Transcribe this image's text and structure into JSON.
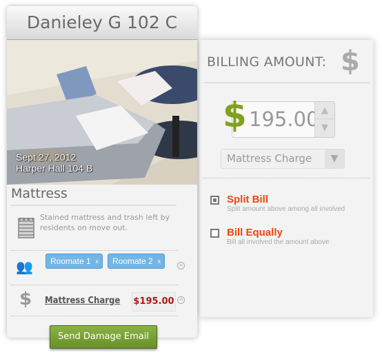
{
  "card": {
    "title": "Danieley G 102 C",
    "photo": {
      "date": "Sept 27, 2012",
      "location": "Harper Hall 104 B"
    },
    "item_title": "Mattress",
    "description": "Stained mattress and trash left by residents on move out.",
    "roommates": [
      {
        "label": "Roomate 1",
        "remove": "x"
      },
      {
        "label": "Roomate 2",
        "remove": "x"
      }
    ],
    "charge_label": "Mattress Charge",
    "charge_amount": "$195.00",
    "send_button": "Send Damage Email"
  },
  "billing": {
    "heading": "BILLING AMOUNT:",
    "currency_symbol": "$",
    "amount": "195.00",
    "charge_type": "Mattress Charge",
    "options": [
      {
        "label": "Split Bill",
        "sub": "Split amount above among all involved",
        "checked": true
      },
      {
        "label": "Bill Equally",
        "sub": "Bill all involved the amount above",
        "checked": false
      }
    ],
    "accent_color": "#e8470f",
    "currency_color": "#7fa21c"
  }
}
